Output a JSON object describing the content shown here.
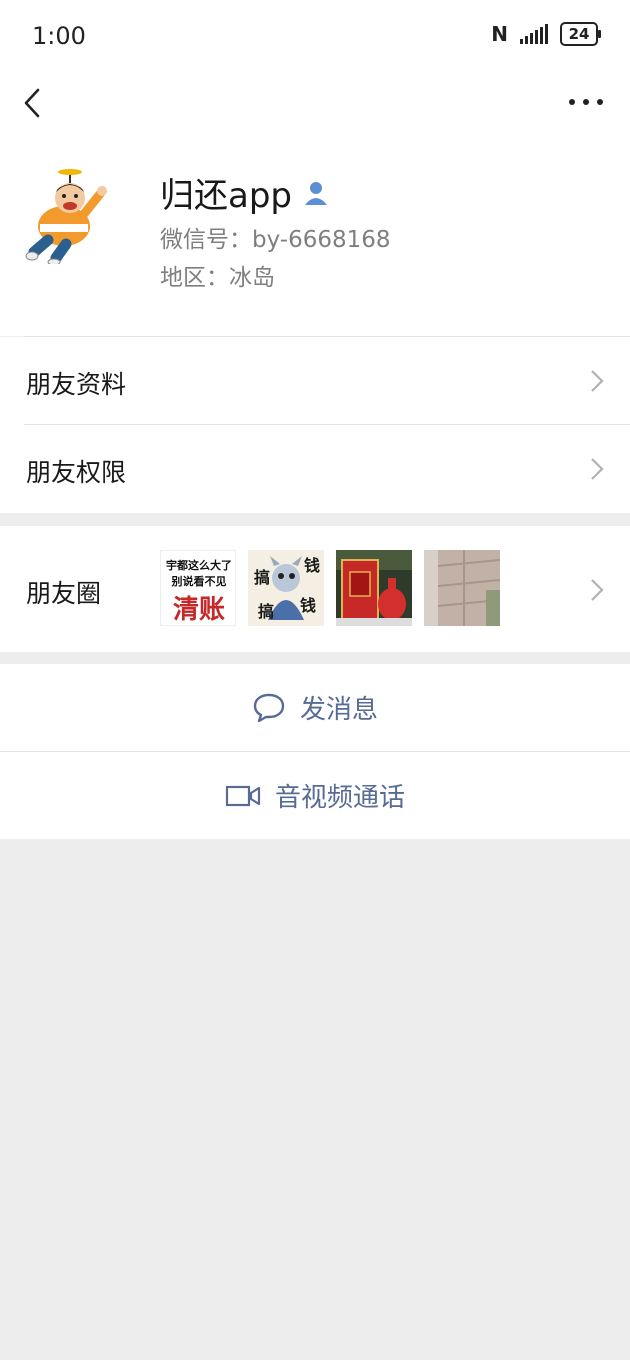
{
  "status": {
    "time": "1:00",
    "nfc": "N",
    "battery": "24"
  },
  "profile": {
    "name": "归还app",
    "wechat_id": "微信号：by-6668168",
    "region": "地区：冰岛"
  },
  "menu": {
    "friend_profile": "朋友资料",
    "friend_permissions": "朋友权限",
    "moments": "朋友圈"
  },
  "thumb1": {
    "line1": "宇都这么大了",
    "line2": "别说看不见",
    "big": "清账"
  },
  "thumb2": {
    "c1": "搞",
    "c2": "钱",
    "c3": "搞",
    "c4": "钱"
  },
  "actions": {
    "message": "发消息",
    "video_call": "音视频通话"
  },
  "colors": {
    "link": "#576b95",
    "bg": "#ededed"
  }
}
